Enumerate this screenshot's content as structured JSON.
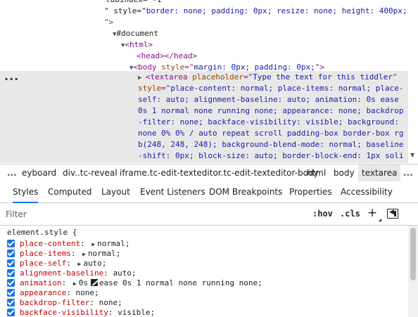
{
  "dom_tree": {
    "lines": [
      {
        "pre": "",
        "tri": "",
        "segments": [
          {
            "t": "tabindex=\"-1\"",
            "c": "txt"
          }
        ]
      },
      {
        "pre": "",
        "tri": "",
        "segments": [
          {
            "t": "\" style=",
            "c": "txt"
          },
          {
            "t": "\"border: none; padding: 0px; resize: none; height: 400px;",
            "c": "val"
          }
        ]
      },
      {
        "pre": "",
        "tri": "",
        "segments": [
          {
            "t": "\">",
            "c": "tag"
          }
        ]
      },
      {
        "pre": "",
        "tri": "▼",
        "segments": [
          {
            "t": "#document",
            "c": "txt"
          }
        ]
      },
      {
        "pre": "",
        "tri": "▼",
        "segments": [
          {
            "t": "<html>",
            "c": "tag"
          }
        ]
      },
      {
        "pre": "",
        "tri": "",
        "segments": [
          {
            "t": "<head></head>",
            "c": "tag"
          }
        ]
      },
      {
        "pre": "",
        "tri": "▼",
        "segments": [
          {
            "t": "<body ",
            "c": "tag"
          },
          {
            "t": "style",
            "c": "attr"
          },
          {
            "t": "=\"",
            "c": "tag"
          },
          {
            "t": "margin: 0px; padding: 0px;",
            "c": "val"
          },
          {
            "t": "\">",
            "c": "tag"
          }
        ]
      }
    ],
    "selected_dots": "...",
    "selected_lines": [
      [
        {
          "t": "<textarea ",
          "c": "tag"
        },
        {
          "t": "placeholder",
          "c": "attr"
        },
        {
          "t": "=\"",
          "c": "tag"
        },
        {
          "t": "Type the text for this tiddler",
          "c": "val"
        },
        {
          "t": "\"",
          "c": "tag"
        }
      ],
      [
        {
          "t": "style",
          "c": "attr"
        },
        {
          "t": "=\"",
          "c": "tag"
        },
        {
          "t": "place-content: normal; place-items: normal; place-",
          "c": "val"
        }
      ],
      [
        {
          "t": "self: auto; alignment-baseline: auto; animation: 0s ease",
          "c": "val"
        }
      ],
      [
        {
          "t": "0s 1 normal none running none; appearance: none; backdrop",
          "c": "val"
        }
      ],
      [
        {
          "t": "-filter: none; backface-visibility: visible; background:",
          "c": "val"
        }
      ],
      [
        {
          "t": "none 0% 0% / auto repeat scroll padding-box border-box rg",
          "c": "val"
        }
      ],
      [
        {
          "t": "b(248, 248, 248); background-blend-mode: normal; baseline",
          "c": "val"
        }
      ],
      [
        {
          "t": "-shift: 0px; block-size: auto; border-block-end: 1px soli",
          "c": "val"
        }
      ]
    ]
  },
  "breadcrumb": {
    "more_left": "...",
    "items": [
      "eyboard",
      "div..tc-reveal",
      "iframe.tc-edit-texteditor.tc-edit-texteditor-body",
      "html",
      "body",
      "textarea"
    ],
    "more_right": "..."
  },
  "tabs": [
    "Styles",
    "Computed",
    "Layout",
    "Event Listeners",
    "DOM Breakpoints",
    "Properties",
    "Accessibility"
  ],
  "filter": {
    "placeholder": "Filter",
    "hov": ":hov",
    "cls": ".cls",
    "plus": "+"
  },
  "styles": {
    "selector": "element.style {",
    "properties": [
      {
        "name": "place-content",
        "value": "normal",
        "expand": true,
        "swatch": false
      },
      {
        "name": "place-items",
        "value": "normal",
        "expand": true,
        "swatch": false
      },
      {
        "name": "place-self",
        "value": "auto",
        "expand": true,
        "swatch": false
      },
      {
        "name": "alignment-baseline",
        "value": "auto",
        "expand": false,
        "swatch": false
      },
      {
        "name": "animation",
        "value_pre": "0s",
        "value": "ease 0s 1 normal none running none",
        "expand": true,
        "swatch": true
      },
      {
        "name": "appearance",
        "value": "none",
        "expand": false,
        "swatch": false
      },
      {
        "name": "backdrop-filter",
        "value": "none",
        "expand": false,
        "swatch": false
      },
      {
        "name": "backface-visibility",
        "value": "visible",
        "expand": false,
        "swatch": false
      }
    ]
  },
  "colors": {
    "accent": "#1a73e8",
    "tag": "#881280",
    "attr": "#994500",
    "attr_value": "#1a1aa6",
    "prop_name": "#c80000",
    "selected_bg": "#e8e8e8"
  }
}
